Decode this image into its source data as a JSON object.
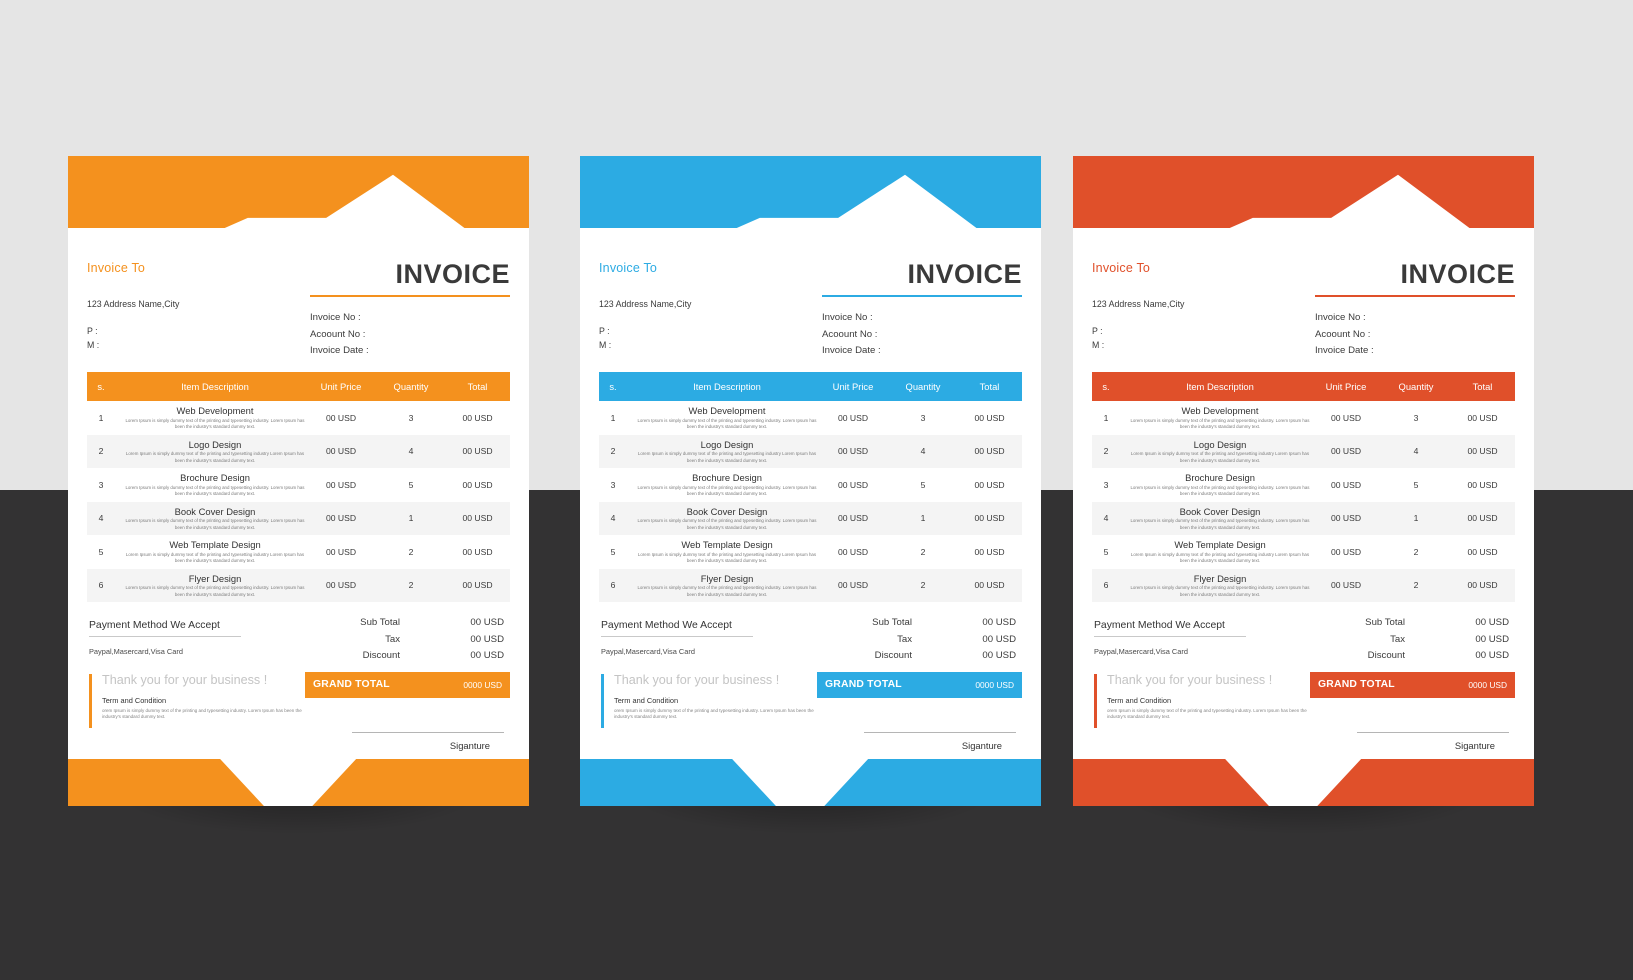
{
  "scene": {
    "background_top_color": "#e5e5e5",
    "background_bottom_color": "#333233"
  },
  "theme_colors": {
    "orange": "#f4911e",
    "blue": "#2cabe3",
    "red": "#e0502a"
  },
  "invoice": {
    "invoice_to_label": "Invoice To",
    "address": "123 Address Name,City",
    "phone_label": "P :",
    "mobile_label": "M :",
    "title": "INVOICE",
    "meta": [
      "Invoice No :",
      "Acoount No :",
      "Invoice Date :"
    ],
    "table": {
      "headers": {
        "sl": "s.",
        "description": "Item Description",
        "unit_price": "Unit Price",
        "quantity": "Quantity",
        "total": "Total"
      },
      "rows": [
        {
          "sl": "1",
          "title": "Web Development",
          "sub": "Lorem Ipsum is simply dummy text of the printing and typesetting industry. Lorem Ipsum has been the industry's standard dummy text.",
          "unit_price": "00 USD",
          "quantity": "3",
          "total": "00 USD"
        },
        {
          "sl": "2",
          "title": "Logo Design",
          "sub": "Lorem Ipsum is simply dummy text of the printing and typesetting industry Lorem Ipsum has been the industry's standard dummy text.",
          "unit_price": "00 USD",
          "quantity": "4",
          "total": "00 USD"
        },
        {
          "sl": "3",
          "title": "Brochure Design",
          "sub": "Lorem Ipsum is simply dummy text of the printing and typesetting industry. Lorem Ipsum has been the industry's standard dummy text.",
          "unit_price": "00 USD",
          "quantity": "5",
          "total": "00 USD"
        },
        {
          "sl": "4",
          "title": "Book Cover Design",
          "sub": "Lorem Ipsum is simply dummy text of the printing and typesetting industry. Lorem Ipsum has been the industry's standard dummy text.",
          "unit_price": "00 USD",
          "quantity": "1",
          "total": "00 USD"
        },
        {
          "sl": "5",
          "title": "Web Template Design",
          "sub": "Lorem Ipsum is simply dummy text of the printing and typesetting industry Lorem Ipsum has been the industry's standard dummy text.",
          "unit_price": "00 USD",
          "quantity": "2",
          "total": "00 USD"
        },
        {
          "sl": "6",
          "title": "Flyer Design",
          "sub": "Lorem Ipsum is simply dummy text of the printing and typesetting industry. Lorem Ipsum has been the industry's standard dummy text.",
          "unit_price": "00 USD",
          "quantity": "2",
          "total": "00 USD"
        }
      ]
    },
    "payment": {
      "title": "Payment Method We Accept",
      "methods": "Paypal,Masercard,Visa Card"
    },
    "thanks": "Thank you for your business !",
    "terms": {
      "title": "Term and Condition",
      "body": "orem Ipsum is simply dummy text of the printing and typesetting industry. Lorem Ipsum has been the industry's standard dummy text."
    },
    "totals": [
      {
        "label": "Sub Total",
        "value": "00 USD"
      },
      {
        "label": "Tax",
        "value": "00 USD"
      },
      {
        "label": "Discount",
        "value": "00 USD"
      }
    ],
    "grand_total": {
      "label": "GRAND TOTAL",
      "value": "0000 USD"
    },
    "signature_label": "Siganture"
  }
}
